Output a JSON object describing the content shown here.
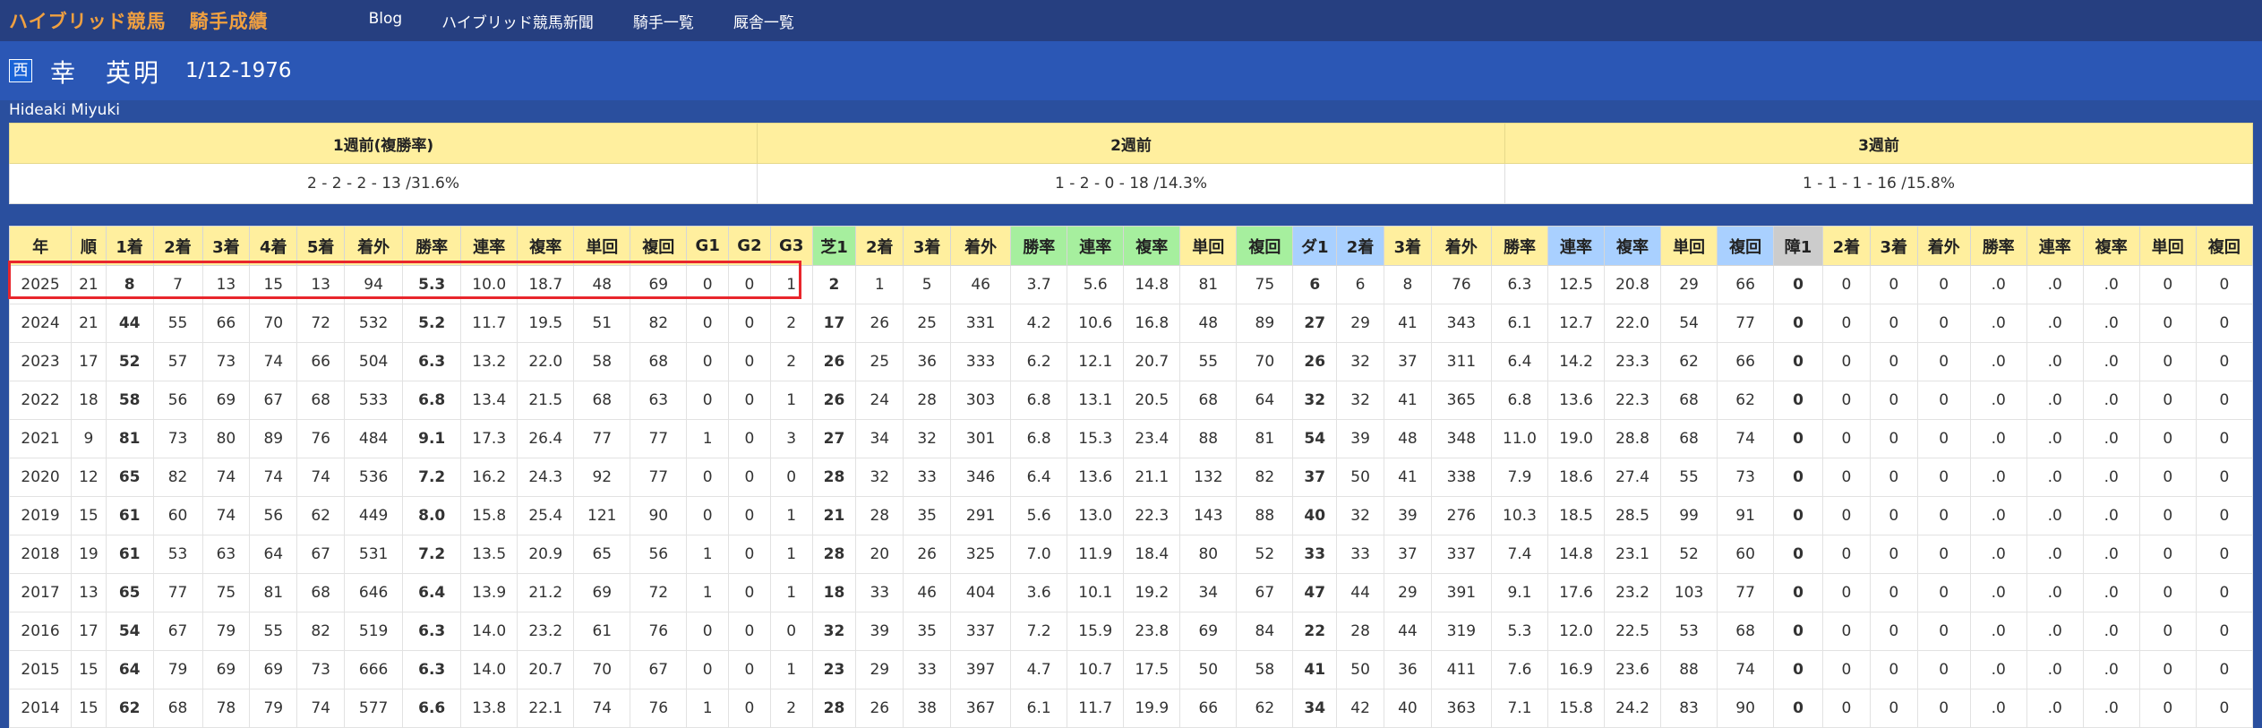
{
  "site": {
    "brand": "ハイブリッド競馬",
    "section": "騎手成績",
    "nav": [
      "Blog",
      "ハイブリッド競馬新聞",
      "騎手一覧",
      "厩舎一覧"
    ]
  },
  "jockey": {
    "region": "西",
    "name": "幸　英明",
    "birth": "1/12-1976",
    "roman": "Hideaki Miyuki"
  },
  "weeks": {
    "headers": [
      "1週前(複勝率)",
      "2週前",
      "3週前"
    ],
    "values": [
      "2 - 2 - 2 - 13 /31.6%",
      "1 - 2 - 0 - 18 /14.3%",
      "1 - 1 - 1 - 16 /15.8%"
    ]
  },
  "stats": {
    "headers": [
      {
        "label": "年",
        "group": "y"
      },
      {
        "label": "順",
        "group": "y"
      },
      {
        "label": "1着",
        "group": "y"
      },
      {
        "label": "2着",
        "group": "y"
      },
      {
        "label": "3着",
        "group": "y"
      },
      {
        "label": "4着",
        "group": "y"
      },
      {
        "label": "5着",
        "group": "y"
      },
      {
        "label": "着外",
        "group": "y"
      },
      {
        "label": "勝率",
        "group": "y"
      },
      {
        "label": "連率",
        "group": "y"
      },
      {
        "label": "複率",
        "group": "y"
      },
      {
        "label": "単回",
        "group": "y"
      },
      {
        "label": "複回",
        "group": "y"
      },
      {
        "label": "G1",
        "group": "y"
      },
      {
        "label": "G2",
        "group": "y"
      },
      {
        "label": "G3",
        "group": "y"
      },
      {
        "label": "芝1",
        "group": "g"
      },
      {
        "label": "2着",
        "group": "y"
      },
      {
        "label": "3着",
        "group": "y"
      },
      {
        "label": "着外",
        "group": "y"
      },
      {
        "label": "勝率",
        "group": "g"
      },
      {
        "label": "連率",
        "group": "g"
      },
      {
        "label": "複率",
        "group": "g"
      },
      {
        "label": "単回",
        "group": "y"
      },
      {
        "label": "複回",
        "group": "g"
      },
      {
        "label": "ダ1",
        "group": "b"
      },
      {
        "label": "2着",
        "group": "b"
      },
      {
        "label": "3着",
        "group": "y"
      },
      {
        "label": "着外",
        "group": "y"
      },
      {
        "label": "勝率",
        "group": "y"
      },
      {
        "label": "連率",
        "group": "b"
      },
      {
        "label": "複率",
        "group": "b"
      },
      {
        "label": "単回",
        "group": "y"
      },
      {
        "label": "複回",
        "group": "b"
      },
      {
        "label": "障1",
        "group": "gr"
      },
      {
        "label": "2着",
        "group": "y"
      },
      {
        "label": "3着",
        "group": "y"
      },
      {
        "label": "着外",
        "group": "y"
      },
      {
        "label": "勝率",
        "group": "y"
      },
      {
        "label": "連率",
        "group": "y"
      },
      {
        "label": "複率",
        "group": "y"
      },
      {
        "label": "単回",
        "group": "y"
      },
      {
        "label": "複回",
        "group": "y"
      }
    ],
    "bold_columns": [
      2,
      8,
      16,
      25,
      34
    ],
    "rows": [
      [
        "2025",
        "21",
        "8",
        "7",
        "13",
        "15",
        "13",
        "94",
        "5.3",
        "10.0",
        "18.7",
        "48",
        "69",
        "0",
        "0",
        "1",
        "2",
        "1",
        "5",
        "46",
        "3.7",
        "5.6",
        "14.8",
        "81",
        "75",
        "6",
        "6",
        "8",
        "76",
        "6.3",
        "12.5",
        "20.8",
        "29",
        "66",
        "0",
        "0",
        "0",
        "0",
        ".0",
        ".0",
        ".0",
        "0",
        "0"
      ],
      [
        "2024",
        "21",
        "44",
        "55",
        "66",
        "70",
        "72",
        "532",
        "5.2",
        "11.7",
        "19.5",
        "51",
        "82",
        "0",
        "0",
        "2",
        "17",
        "26",
        "25",
        "331",
        "4.2",
        "10.6",
        "16.8",
        "48",
        "89",
        "27",
        "29",
        "41",
        "343",
        "6.1",
        "12.7",
        "22.0",
        "54",
        "77",
        "0",
        "0",
        "0",
        "0",
        ".0",
        ".0",
        ".0",
        "0",
        "0"
      ],
      [
        "2023",
        "17",
        "52",
        "57",
        "73",
        "74",
        "66",
        "504",
        "6.3",
        "13.2",
        "22.0",
        "58",
        "68",
        "0",
        "0",
        "2",
        "26",
        "25",
        "36",
        "333",
        "6.2",
        "12.1",
        "20.7",
        "55",
        "70",
        "26",
        "32",
        "37",
        "311",
        "6.4",
        "14.2",
        "23.3",
        "62",
        "66",
        "0",
        "0",
        "0",
        "0",
        ".0",
        ".0",
        ".0",
        "0",
        "0"
      ],
      [
        "2022",
        "18",
        "58",
        "56",
        "69",
        "67",
        "68",
        "533",
        "6.8",
        "13.4",
        "21.5",
        "68",
        "63",
        "0",
        "0",
        "1",
        "26",
        "24",
        "28",
        "303",
        "6.8",
        "13.1",
        "20.5",
        "68",
        "64",
        "32",
        "32",
        "41",
        "365",
        "6.8",
        "13.6",
        "22.3",
        "68",
        "62",
        "0",
        "0",
        "0",
        "0",
        ".0",
        ".0",
        ".0",
        "0",
        "0"
      ],
      [
        "2021",
        "9",
        "81",
        "73",
        "80",
        "89",
        "76",
        "484",
        "9.1",
        "17.3",
        "26.4",
        "77",
        "77",
        "1",
        "0",
        "3",
        "27",
        "34",
        "32",
        "301",
        "6.8",
        "15.3",
        "23.4",
        "88",
        "81",
        "54",
        "39",
        "48",
        "348",
        "11.0",
        "19.0",
        "28.8",
        "68",
        "74",
        "0",
        "0",
        "0",
        "0",
        ".0",
        ".0",
        ".0",
        "0",
        "0"
      ],
      [
        "2020",
        "12",
        "65",
        "82",
        "74",
        "74",
        "74",
        "536",
        "7.2",
        "16.2",
        "24.3",
        "92",
        "77",
        "0",
        "0",
        "0",
        "28",
        "32",
        "33",
        "346",
        "6.4",
        "13.6",
        "21.1",
        "132",
        "82",
        "37",
        "50",
        "41",
        "338",
        "7.9",
        "18.6",
        "27.4",
        "55",
        "73",
        "0",
        "0",
        "0",
        "0",
        ".0",
        ".0",
        ".0",
        "0",
        "0"
      ],
      [
        "2019",
        "15",
        "61",
        "60",
        "74",
        "56",
        "62",
        "449",
        "8.0",
        "15.8",
        "25.4",
        "121",
        "90",
        "0",
        "0",
        "1",
        "21",
        "28",
        "35",
        "291",
        "5.6",
        "13.0",
        "22.3",
        "143",
        "88",
        "40",
        "32",
        "39",
        "276",
        "10.3",
        "18.5",
        "28.5",
        "99",
        "91",
        "0",
        "0",
        "0",
        "0",
        ".0",
        ".0",
        ".0",
        "0",
        "0"
      ],
      [
        "2018",
        "19",
        "61",
        "53",
        "63",
        "64",
        "67",
        "531",
        "7.2",
        "13.5",
        "20.9",
        "65",
        "56",
        "1",
        "0",
        "1",
        "28",
        "20",
        "26",
        "325",
        "7.0",
        "11.9",
        "18.4",
        "80",
        "52",
        "33",
        "33",
        "37",
        "337",
        "7.4",
        "14.8",
        "23.1",
        "52",
        "60",
        "0",
        "0",
        "0",
        "0",
        ".0",
        ".0",
        ".0",
        "0",
        "0"
      ],
      [
        "2017",
        "13",
        "65",
        "77",
        "75",
        "81",
        "68",
        "646",
        "6.4",
        "13.9",
        "21.2",
        "69",
        "72",
        "1",
        "0",
        "1",
        "18",
        "33",
        "46",
        "404",
        "3.6",
        "10.1",
        "19.2",
        "34",
        "67",
        "47",
        "44",
        "29",
        "391",
        "9.1",
        "17.6",
        "23.2",
        "103",
        "77",
        "0",
        "0",
        "0",
        "0",
        ".0",
        ".0",
        ".0",
        "0",
        "0"
      ],
      [
        "2016",
        "17",
        "54",
        "67",
        "79",
        "55",
        "82",
        "519",
        "6.3",
        "14.0",
        "23.2",
        "61",
        "76",
        "0",
        "0",
        "0",
        "32",
        "39",
        "35",
        "337",
        "7.2",
        "15.9",
        "23.8",
        "69",
        "84",
        "22",
        "28",
        "44",
        "319",
        "5.3",
        "12.0",
        "22.5",
        "53",
        "68",
        "0",
        "0",
        "0",
        "0",
        ".0",
        ".0",
        ".0",
        "0",
        "0"
      ],
      [
        "2015",
        "15",
        "64",
        "79",
        "69",
        "69",
        "73",
        "666",
        "6.3",
        "14.0",
        "20.7",
        "70",
        "67",
        "0",
        "0",
        "1",
        "23",
        "29",
        "33",
        "397",
        "4.7",
        "10.7",
        "17.5",
        "50",
        "58",
        "41",
        "50",
        "36",
        "411",
        "7.6",
        "16.9",
        "23.6",
        "88",
        "74",
        "0",
        "0",
        "0",
        "0",
        ".0",
        ".0",
        ".0",
        "0",
        "0"
      ],
      [
        "2014",
        "15",
        "62",
        "68",
        "78",
        "79",
        "74",
        "577",
        "6.6",
        "13.8",
        "22.1",
        "74",
        "76",
        "1",
        "0",
        "2",
        "28",
        "26",
        "38",
        "367",
        "6.1",
        "11.7",
        "19.9",
        "66",
        "62",
        "34",
        "42",
        "40",
        "363",
        "7.1",
        "15.8",
        "24.2",
        "83",
        "90",
        "0",
        "0",
        "0",
        "0",
        ".0",
        ".0",
        ".0",
        "0",
        "0"
      ]
    ]
  }
}
